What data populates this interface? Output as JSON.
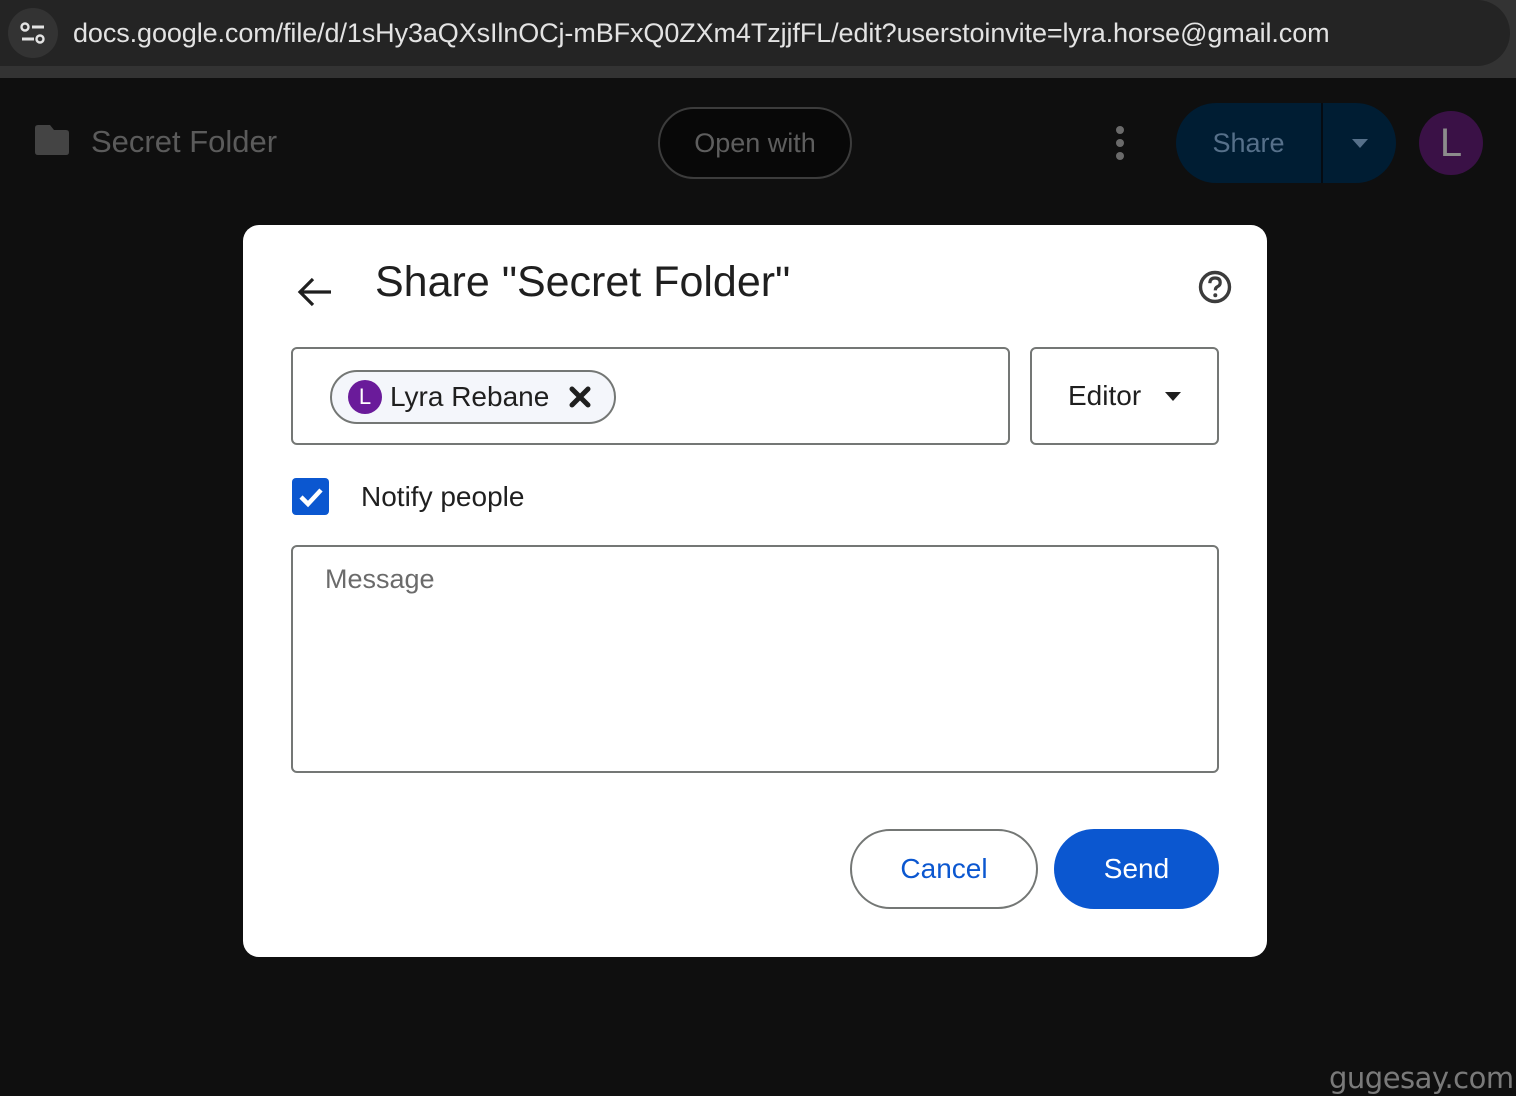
{
  "browser": {
    "url": "docs.google.com/file/d/1sHy3aQXsIlnOCj-mBFxQ0ZXm4TzjjfFL/edit?userstoinvite=lyra.horse@gmail.com",
    "site_info_icon": "tune-icon"
  },
  "app_header": {
    "folder_icon": "folder-icon",
    "title": "Secret Folder",
    "open_with_label": "Open with",
    "more_icon": "more-vert-icon",
    "share_label": "Share",
    "share_dropdown_icon": "caret-down-icon",
    "avatar_initial": "L",
    "avatar_color": "#3a1146"
  },
  "dialog": {
    "back_icon": "arrow-left-icon",
    "title": "Share \"Secret Folder\"",
    "help_icon": "help-circle-icon",
    "recipients": [
      {
        "initial": "L",
        "name": "Lyra Rebane",
        "avatar_color": "#6a1b9a",
        "remove_icon": "close-icon"
      }
    ],
    "role": {
      "selected": "Editor",
      "caret_icon": "caret-down-icon"
    },
    "notify": {
      "label": "Notify people",
      "checked": true
    },
    "message": {
      "placeholder": "Message",
      "value": ""
    },
    "buttons": {
      "cancel": "Cancel",
      "send": "Send"
    },
    "accent_color": "#0b57d0"
  },
  "watermark": "gugesay.com"
}
